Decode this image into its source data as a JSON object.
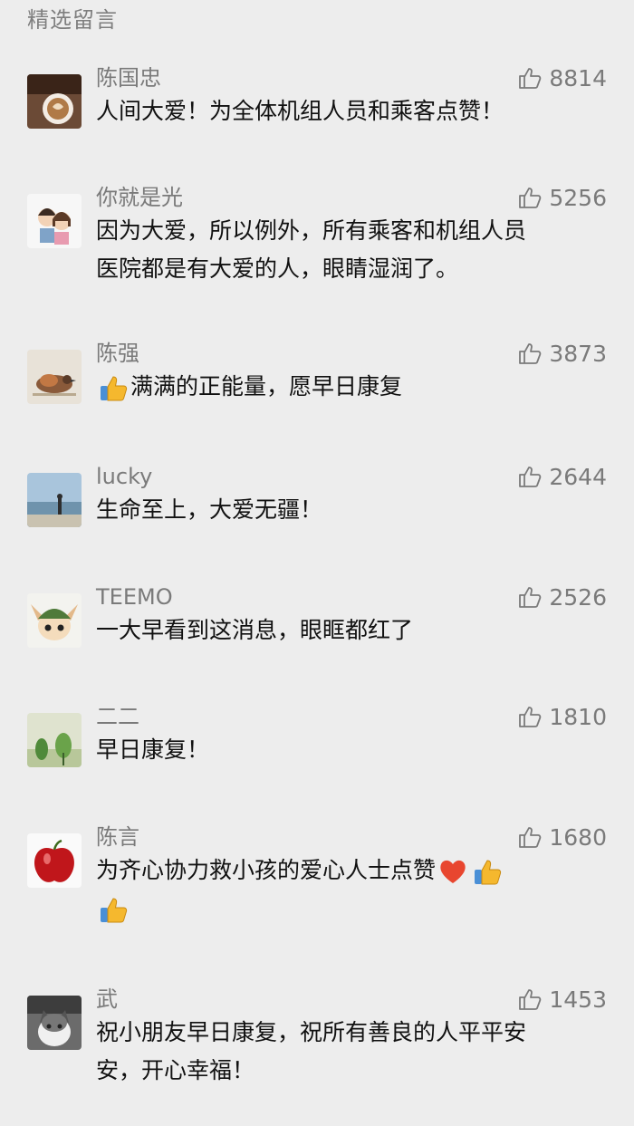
{
  "section_title": "精选留言",
  "comments": [
    {
      "name": "陈国忠",
      "likes": "8814",
      "line1": "人间大爱！为全体机组人员和乘客点赞！",
      "line2": "",
      "avatar": "coffee-avatar"
    },
    {
      "name": "你就是光",
      "likes": "5256",
      "line1": "因为大爱，所以例外，所有乘客和机组人员",
      "line2": "医院都是有大爱的人，眼睛湿润了。",
      "avatar": "cartoon-couple-avatar"
    },
    {
      "name": "陈强",
      "likes": "3873",
      "line1": "满满的正能量，愿早日康复",
      "line2": "",
      "avatar": "bird-avatar"
    },
    {
      "name": "lucky",
      "likes": "2644",
      "line1": "生命至上，大爱无疆！",
      "line2": "",
      "avatar": "seaside-person-avatar"
    },
    {
      "name": "TEEMO",
      "likes": "2526",
      "line1": "一大早看到这消息，眼眶都红了",
      "line2": "",
      "avatar": "teemo-avatar"
    },
    {
      "name": "二二",
      "likes": "1810",
      "line1": "早日康复！",
      "line2": "",
      "avatar": "plant-avatar"
    },
    {
      "name": "陈言",
      "likes": "1680",
      "line1": "为齐心协力救小孩的爱心人士点赞",
      "line2": "",
      "avatar": "apple-avatar"
    },
    {
      "name": "武",
      "likes": "1453",
      "line1": "祝小朋友早日康复，祝所有善良的人平平安",
      "line2": "安，开心幸福！",
      "avatar": "cat-avatar"
    }
  ],
  "icons": {
    "like": "thumbs-up-outline-icon",
    "thumbs_emoji": "thumbs-up-emoji",
    "heart_emoji": "red-heart-emoji"
  },
  "colors": {
    "background": "#ededed",
    "meta_text": "#7a7a7a",
    "body_text": "#111111",
    "heart": "#e8462f",
    "thumb": "#f5b82e"
  }
}
